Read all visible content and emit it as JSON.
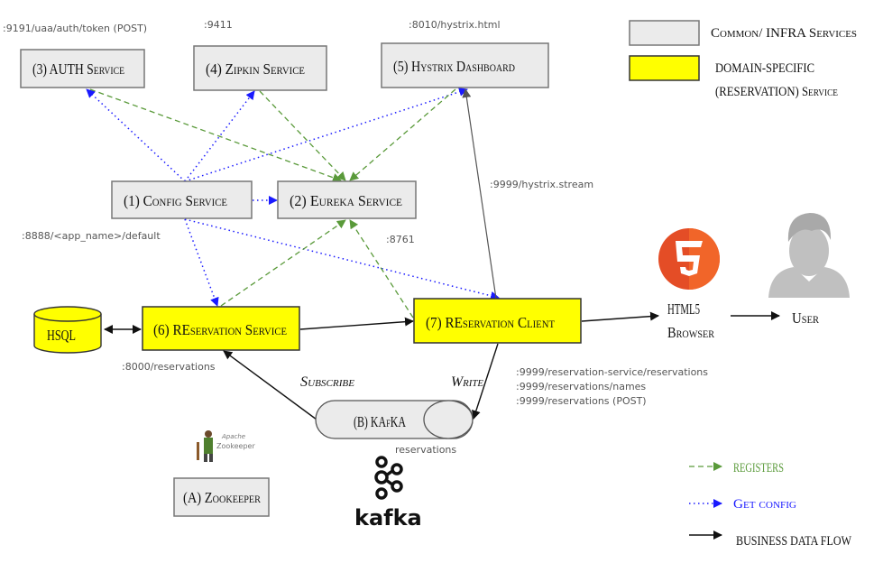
{
  "nodes": {
    "auth": {
      "label": "(3) AUTH Service",
      "port": ":9191/uaa/auth/token (POST)"
    },
    "zipkin": {
      "label": "(4) Zipkin Service",
      "port": ":9411"
    },
    "hystrix": {
      "label": "(5) Hystrix Dashboard",
      "port": ":8010/hystrix.html"
    },
    "config": {
      "label": "(1) Config Service",
      "port": ":8888/<app_name>/default"
    },
    "eureka": {
      "label": "(2) Eureka Service",
      "port": ":8761"
    },
    "hsql": {
      "label": "HSQL"
    },
    "reservation_service": {
      "label": "(6) REservation Service",
      "port": ":8000/reservations"
    },
    "reservation_client": {
      "label": "(7) REservation Client",
      "hystrix_stream": ":9999/hystrix.stream",
      "endpoints": [
        ":9999/reservation-service/reservations",
        ":9999/reservations/names",
        ":9999/reservations (POST)"
      ]
    },
    "kafka": {
      "label": "(B) KAfKA",
      "topic": "reservations",
      "logo_text": "kafka"
    },
    "zookeeper": {
      "label": "(A) Zookeeper",
      "logo_text": [
        "Apache",
        "Zookeeper"
      ]
    },
    "browser": {
      "label": [
        "HTML5",
        "Browser"
      ],
      "icon": "html5-icon"
    },
    "user": {
      "label": "User",
      "icon": "user-avatar-icon"
    }
  },
  "edges": {
    "subscribe": "Subscribe",
    "write": "Write"
  },
  "legend": {
    "common": "Common/ INFRA Services",
    "domain": [
      "DOMAIN-SPECIFIC",
      "(RESERVATION) Service"
    ],
    "registers": "REGISTERS",
    "get_config": "Get config",
    "business": "BUSINESS DATA FLOW"
  },
  "colors": {
    "infra": "#ebebeb",
    "domain": "#ffff00",
    "registers": "#5a9a3a",
    "config": "#1a1aff",
    "business": "#111111",
    "html5": "#e44d26",
    "user": "#c0c0c0"
  }
}
